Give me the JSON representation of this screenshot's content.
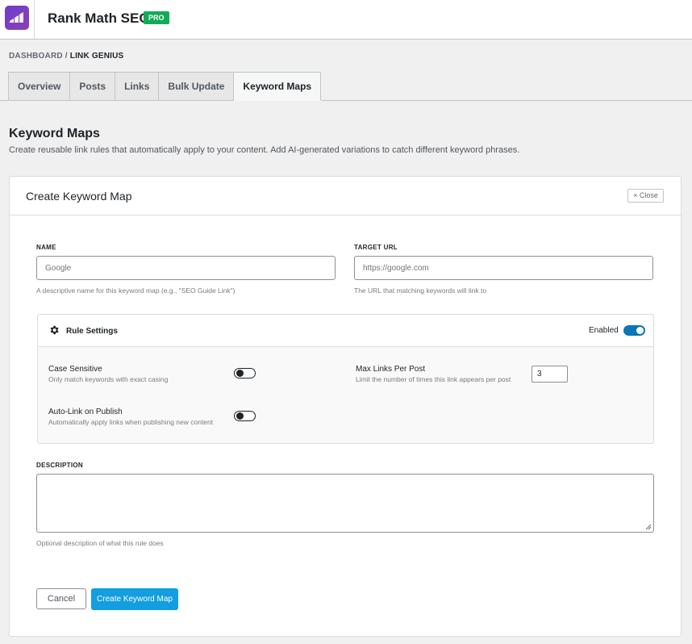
{
  "app": {
    "title": "Rank Math SEO",
    "badge": "PRO",
    "logo_icon": "rank-math-logo",
    "badge_color": "#10ac58"
  },
  "breadcrumb": {
    "parent": "DASHBOARD",
    "separator": "/",
    "current": "LINK GENIUS"
  },
  "tabs": [
    {
      "label": "Overview",
      "active": false
    },
    {
      "label": "Posts",
      "active": false
    },
    {
      "label": "Links",
      "active": false
    },
    {
      "label": "Bulk Update",
      "active": false
    },
    {
      "label": "Keyword Maps",
      "active": true
    }
  ],
  "page": {
    "title": "Keyword Maps",
    "description": "Create reusable link rules that automatically apply to your content. Add AI-generated variations to catch different keyword phrases."
  },
  "form": {
    "title": "Create Keyword Map",
    "close_label": "Close",
    "name": {
      "label": "NAME",
      "placeholder": "Google",
      "help": "A descriptive name for this keyword map (e.g., \"SEO Guide Link\")"
    },
    "target_url": {
      "label": "TARGET URL",
      "placeholder": "https://google.com",
      "help": "The URL that matching keywords will link to"
    },
    "rule_settings": {
      "title": "Rule Settings",
      "enabled_label": "Enabled",
      "enabled": true,
      "case_sensitive": {
        "title": "Case Sensitive",
        "help": "Only match keywords with exact casing",
        "on": false
      },
      "auto_link": {
        "title": "Auto-Link on Publish",
        "help": "Automatically apply links when publishing new content",
        "on": false
      },
      "max_links": {
        "title": "Max Links Per Post",
        "help": "Limit the number of times this link appears per post",
        "value": "3"
      }
    },
    "description": {
      "label": "DESCRIPTION",
      "help": "Optional description of what this rule does",
      "value": ""
    },
    "cancel_label": "Cancel",
    "submit_label": "Create Keyword Map"
  },
  "colors": {
    "accent": "#129ee0",
    "toggle_on": "#0a76b8",
    "background": "#f0f0f1"
  }
}
